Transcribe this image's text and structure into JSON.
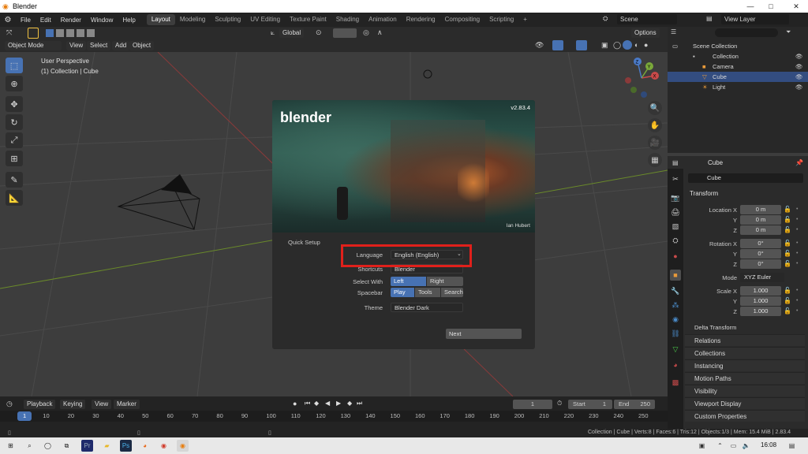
{
  "window": {
    "title": "Blender",
    "minimize": "—",
    "maximize": "□",
    "close": "✕"
  },
  "menubar": {
    "menus": [
      "File",
      "Edit",
      "Render",
      "Window",
      "Help"
    ],
    "workspaces": [
      "Layout",
      "Modeling",
      "Sculpting",
      "UV Editing",
      "Texture Paint",
      "Shading",
      "Animation",
      "Rendering",
      "Compositing",
      "Scripting"
    ],
    "active_workspace": "Layout",
    "add_tab": "+",
    "scene": "Scene",
    "view_layer": "View Layer"
  },
  "header": {
    "transform_orientation": "Global",
    "options": "Options",
    "mode": "Object Mode",
    "menus": [
      "View",
      "Select",
      "Add",
      "Object"
    ]
  },
  "viewport": {
    "perspective": "User Perspective",
    "collection": "(1) Collection | Cube",
    "gizmo_axes": {
      "x": "X",
      "y": "Y",
      "z": "Z"
    }
  },
  "splash": {
    "version": "v2.83.4",
    "logo": "blender",
    "credit": "Ian Hubert",
    "quick_setup": "Quick Setup",
    "language_label": "Language",
    "language_value": "English (English)",
    "shortcuts_label": "Shortcuts",
    "shortcuts_value": "Blender",
    "select_with_label": "Select With",
    "select_left": "Left",
    "select_right": "Right",
    "spacebar_label": "Spacebar",
    "spacebar_play": "Play",
    "spacebar_tools": "Tools",
    "spacebar_search": "Search",
    "theme_label": "Theme",
    "theme_value": "Blender Dark",
    "next": "Next",
    "highlight_color": "#e0201b"
  },
  "outliner": {
    "root": "Scene Collection",
    "items": [
      {
        "label": "Collection",
        "selected": false
      },
      {
        "label": "Camera",
        "selected": false
      },
      {
        "label": "Cube",
        "selected": true
      },
      {
        "label": "Light",
        "selected": false
      }
    ]
  },
  "properties": {
    "object_name": "Cube",
    "data_name": "Cube",
    "transform": "Transform",
    "location_x_label": "Location X",
    "y_label": "Y",
    "z_label": "Z",
    "location": [
      "0 m",
      "0 m",
      "0 m"
    ],
    "rotation_x_label": "Rotation X",
    "rotation": [
      "0°",
      "0°",
      "0°"
    ],
    "mode_label": "Mode",
    "mode_value": "XYZ Euler",
    "scale_x_label": "Scale X",
    "scale": [
      "1.000",
      "1.000",
      "1.000"
    ],
    "delta": "Delta Transform",
    "panels": [
      "Relations",
      "Collections",
      "Instancing",
      "Motion Paths",
      "Visibility",
      "Viewport Display",
      "Custom Properties"
    ]
  },
  "timeline": {
    "menus": [
      "Playback",
      "Keying",
      "View",
      "Marker"
    ],
    "current_frame": "1",
    "start_label": "Start",
    "start": "1",
    "end_label": "End",
    "end": "250",
    "ruler": [
      "1",
      "10",
      "20",
      "30",
      "40",
      "50",
      "60",
      "70",
      "80",
      "90",
      "100",
      "110",
      "120",
      "130",
      "140",
      "150",
      "160",
      "170",
      "180",
      "190",
      "200",
      "210",
      "220",
      "230",
      "240",
      "250"
    ]
  },
  "status": {
    "text": "Collection | Cube | Verts:8 | Faces:6 | Tris:12 | Objects:1/3 | Mem: 15.4 MiB | 2.83.4"
  },
  "taskbar": {
    "time": "16:08"
  }
}
